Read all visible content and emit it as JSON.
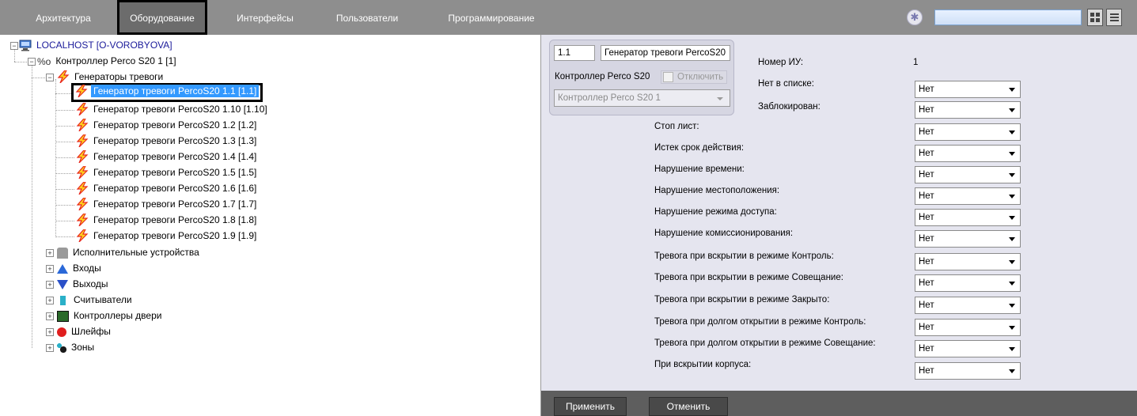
{
  "tabs": [
    {
      "label": "Архитектура",
      "active": false
    },
    {
      "label": "Оборудование",
      "active": true
    },
    {
      "label": "Интерфейсы",
      "active": false
    },
    {
      "label": "Пользователи",
      "active": false
    },
    {
      "label": "Программирование",
      "active": false
    }
  ],
  "toolbar": {
    "search_value": "",
    "gear_icon": "gear-icon",
    "grid_icon": "grid-view-icon",
    "list_icon": "list-view-icon"
  },
  "tree": {
    "root": "LOCALHOST [O-VOROBYOVA]",
    "controller": "Контроллер Perco S20 1 [1]",
    "group": "Генераторы тревоги",
    "generators": [
      "Генератор тревоги PercoS20 1.1 [1.1]",
      "Генератор тревоги PercoS20 1.10 [1.10]",
      "Генератор тревоги PercoS20 1.2 [1.2]",
      "Генератор тревоги PercoS20 1.3 [1.3]",
      "Генератор тревоги PercoS20 1.4 [1.4]",
      "Генератор тревоги PercoS20 1.5 [1.5]",
      "Генератор тревоги PercoS20 1.6 [1.6]",
      "Генератор тревоги PercoS20 1.7 [1.7]",
      "Генератор тревоги PercoS20 1.8 [1.8]",
      "Генератор тревоги PercoS20 1.9 [1.9]"
    ],
    "selected_index": 0,
    "groups": [
      "Исполнительные устройства",
      "Входы",
      "Выходы",
      "Считыватели",
      "Контроллеры двери",
      "Шлейфы",
      "Зоны"
    ]
  },
  "device": {
    "id": "1.1",
    "name": "Генератор тревоги PercoS20",
    "parent_label": "Контроллер Perco S20",
    "disable_label": "Отключить",
    "disabled": false,
    "parent_value": "Контроллер Perco S20 1"
  },
  "props": {
    "number_label": "Номер ИУ:",
    "number_value": "1",
    "not_in_list_label": "Нет в списке:",
    "not_in_list_value": "Нет",
    "blocked_label": "Заблокирован:",
    "blocked_value": "Нет"
  },
  "fields": [
    {
      "label": "Стоп лист:",
      "value": "Нет"
    },
    {
      "label": "Истек срок действия:",
      "value": "Нет"
    },
    {
      "label": "Нарушение времени:",
      "value": "Нет"
    },
    {
      "label": "Нарушение местоположения:",
      "value": "Нет"
    },
    {
      "label": "Нарушение режима доступа:",
      "value": "Нет"
    },
    {
      "label": "Нарушение комиссионирования:",
      "value": "Нет"
    },
    {
      "label": "Тревога при вскрытии в режиме Контроль:",
      "value": "Нет"
    },
    {
      "label": "Тревога при вскрытии в режиме Совещание:",
      "value": "Нет"
    },
    {
      "label": "Тревога при вскрытии в режиме Закрыто:",
      "value": "Нет"
    },
    {
      "label": "Тревога при долгом открытии в режиме Контроль:",
      "value": "Нет"
    },
    {
      "label": "Тревога при долгом открытии в режиме Совещание:",
      "value": "Нет"
    },
    {
      "label": "При вскрытии корпуса:",
      "value": "Нет"
    }
  ],
  "buttons": {
    "apply": "Применить",
    "cancel": "Отменить"
  },
  "colors": {
    "topbar": "#8e8e8e",
    "active_tab": "#6c6c6c",
    "panel": "#e5e5ef",
    "selection": "#3399ff",
    "bolt_red": "#e8281e",
    "bolt_yellow": "#ffd21e"
  }
}
